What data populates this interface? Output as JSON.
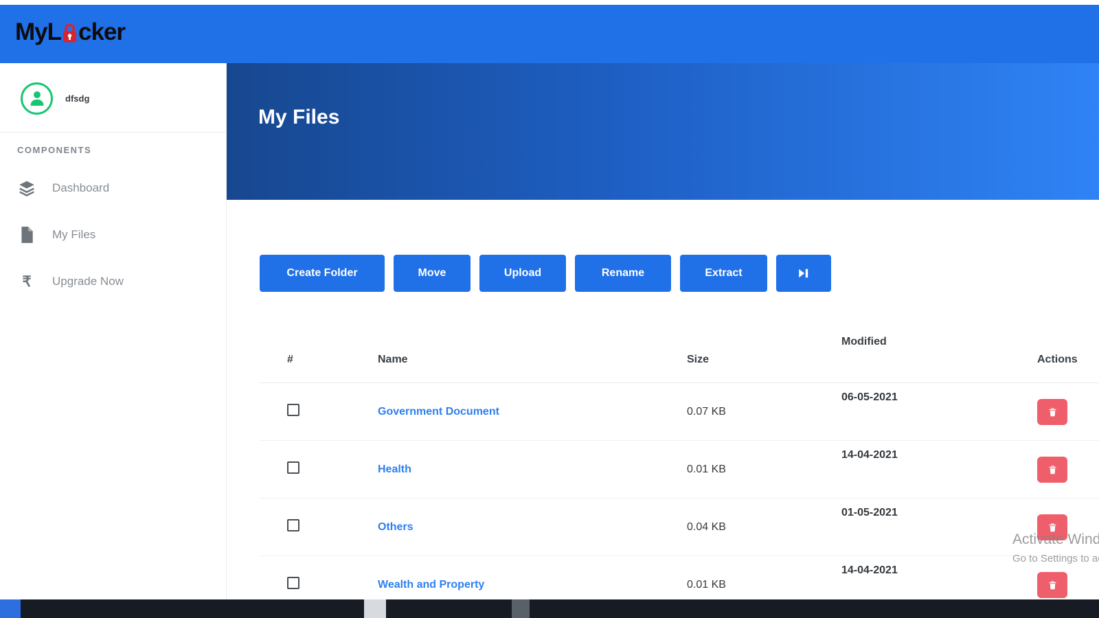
{
  "app": {
    "logo_part1": "MyL",
    "logo_part2": "cker"
  },
  "sidebar": {
    "username": "dfsdg",
    "section_label": "COMPONENTS",
    "items": [
      {
        "label": "Dashboard",
        "icon": "layers"
      },
      {
        "label": "My Files",
        "icon": "file"
      },
      {
        "label": "Upgrade Now",
        "icon": "rupee"
      }
    ]
  },
  "header": {
    "title": "My Files"
  },
  "toolbar": {
    "buttons": [
      "Create Folder",
      "Move",
      "Upload",
      "Rename",
      "Extract"
    ],
    "icon_button": {
      "icon": "skip-forward"
    }
  },
  "table": {
    "columns": [
      "#",
      "Name",
      "Size",
      "Modified",
      "Actions"
    ],
    "rows": [
      {
        "name": "Government Document",
        "size": "0.07 KB",
        "modified": "06-05-2021",
        "checked": false
      },
      {
        "name": "Health",
        "size": "0.01 KB",
        "modified": "14-04-2021",
        "checked": false
      },
      {
        "name": "Others",
        "size": "0.04 KB",
        "modified": "01-05-2021",
        "checked": false
      },
      {
        "name": "Wealth and Property",
        "size": "0.01 KB",
        "modified": "14-04-2021",
        "checked": false
      }
    ]
  },
  "watermark": {
    "line1": "Activate Windows",
    "line2": "Go to Settings to activate Windows."
  },
  "icons": {
    "rupee": "₹"
  },
  "colors": {
    "primary_blue": "#2070e8",
    "banner_gradient_start": "#17478f",
    "banner_gradient_end": "#2f83f6",
    "link_blue": "#2d7ff0",
    "danger_red": "#ef5f6b",
    "avatar_green": "#17c671",
    "lock_red": "#d8242f"
  }
}
